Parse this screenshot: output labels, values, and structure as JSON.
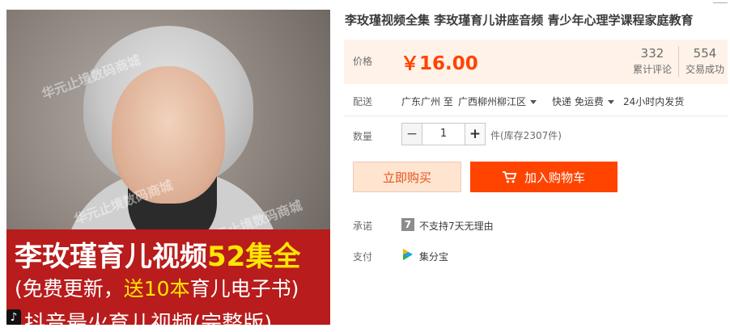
{
  "product": {
    "title": "李玫瑾视频全集 李玫瑾育儿讲座音频 青少年心理学课程家庭教育",
    "image": {
      "watermarks": [
        "华元止境数码商城",
        "华元止境数码商城",
        "华元止境数码商城"
      ],
      "banner_line1_main": "李玫瑾育儿视频",
      "banner_line1_highlight": "52集全",
      "banner_line2_pre": "(免费更新，",
      "banner_line2_highlight": "送10本",
      "banner_line2_post": "育儿电子书)",
      "banner_line3": "抖音最火育儿视频(完整版)"
    }
  },
  "price": {
    "label": "价格",
    "value": "￥16.00",
    "reviews_count": "332",
    "reviews_label": "累计评论",
    "sales_count": "554",
    "sales_label": "交易成功"
  },
  "shipping": {
    "label": "配送",
    "from": "广东广州 至",
    "to": "广西柳州柳江区",
    "method": "快递 免运费",
    "dispatch": "24小时内发货"
  },
  "quantity": {
    "label": "数量",
    "minus": "−",
    "value": "1",
    "plus": "+",
    "stock": "件(库存2307件)"
  },
  "actions": {
    "buy_now": "立即购买",
    "add_to_cart": "加入购物车"
  },
  "promise": {
    "label": "承诺",
    "icon_text": "7",
    "text": "不支持7天无理由"
  },
  "payment": {
    "label": "支付",
    "method": "集分宝"
  },
  "colors": {
    "accent": "#ff4400",
    "price": "#ff4400",
    "price_bg": "#fff2e8",
    "banner": "#b81c1c",
    "banner_highlight": "#ffe600"
  }
}
